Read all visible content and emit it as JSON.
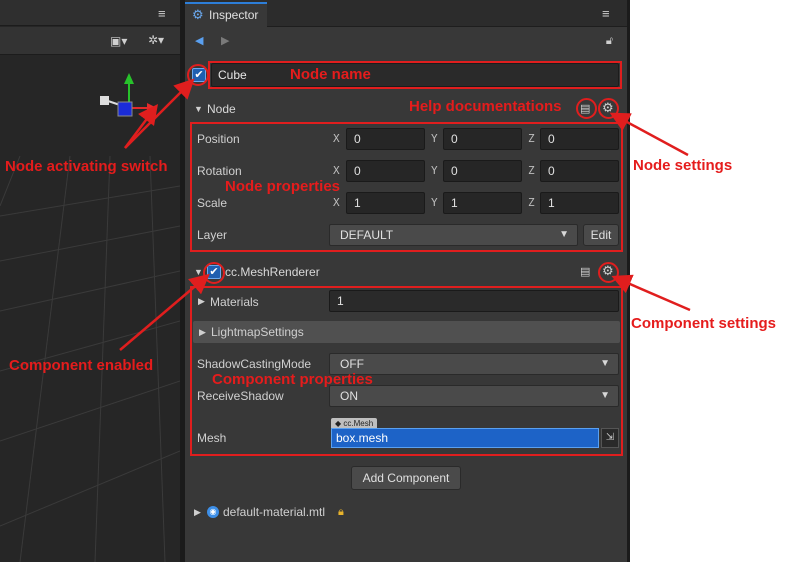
{
  "inspector": {
    "tab_title": "Inspector"
  },
  "node": {
    "name": "Cube",
    "section_title": "Node",
    "properties": [
      {
        "label": "Position",
        "x": "0",
        "y": "0",
        "z": "0"
      },
      {
        "label": "Rotation",
        "x": "0",
        "y": "0",
        "z": "0"
      },
      {
        "label": "Scale",
        "x": "1",
        "y": "1",
        "z": "1"
      }
    ],
    "axis_labels": {
      "x": "X",
      "y": "Y",
      "z": "Z"
    },
    "layer_label": "Layer",
    "layer_value": "DEFAULT",
    "edit_label": "Edit"
  },
  "component": {
    "title": "cc.MeshRenderer",
    "materials_label": "Materials",
    "materials_value": "1",
    "lightmap_label": "LightmapSettings",
    "shadow_casting_label": "ShadowCastingMode",
    "shadow_casting_value": "OFF",
    "receive_shadow_label": "ReceiveShadow",
    "receive_shadow_value": "ON",
    "mesh_label": "Mesh",
    "mesh_type_tag": "cc.Mesh",
    "mesh_value": "box.mesh"
  },
  "add_component_label": "Add Component",
  "asset": {
    "name": "default-material.mtl"
  },
  "annotations": {
    "node_name": "Node name",
    "help_docs": "Help documentations",
    "node_activating": "Node activating switch",
    "node_settings": "Node settings",
    "node_properties": "Node properties",
    "component_settings": "Component settings",
    "component_enabled": "Component enabled",
    "component_properties": "Component properties"
  },
  "colors": {
    "accent": "#2d7ed8",
    "annotation": "#e01e1e",
    "panel_bg": "#383838"
  }
}
